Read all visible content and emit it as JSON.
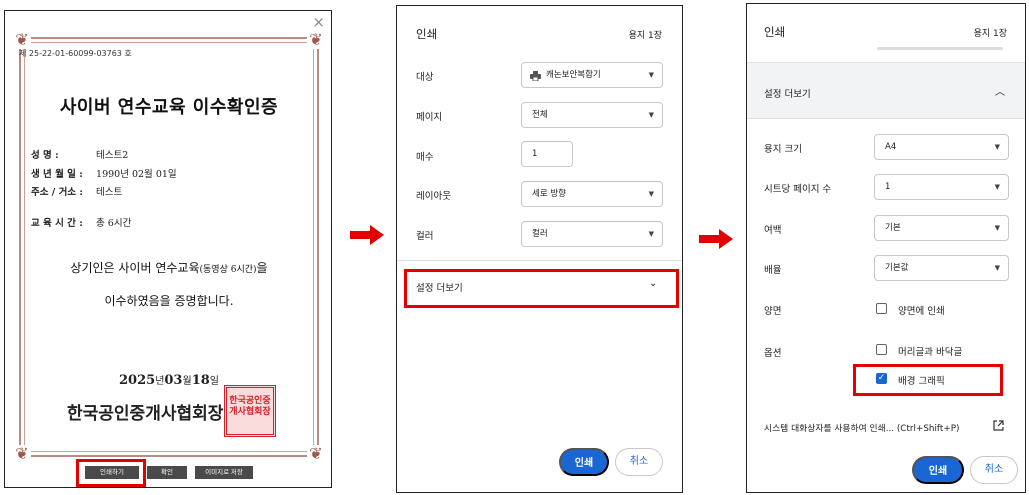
{
  "certificate": {
    "close_glyph": "×",
    "number": "제 25-22-01-60099-03763 호",
    "title": "사이버 연수교육 이수확인증",
    "fields": [
      {
        "label": "성 명 :",
        "value": "테스트2"
      },
      {
        "label": "생 년 월 일 :",
        "value": "1990년 02월 01일"
      },
      {
        "label": "주소 / 거소 :",
        "value": "테스트"
      },
      {
        "label": "교 육 시 간 :",
        "value": "총 6시간"
      }
    ],
    "body_line1_a": "상기인은 사이버 연수교육",
    "body_line1_b": "(동영상 6시간)",
    "body_line1_c": "을",
    "body_line2": "이수하였음을 증명합니다.",
    "date_year": "2025",
    "date_year_unit": "년",
    "date_month": "03",
    "date_month_unit": "월",
    "date_day": "18",
    "date_day_unit": "일",
    "organization": "한국공인중개사협회장",
    "seal_text": "한국공인중개사협회장",
    "buttons": {
      "print": "인쇄하기",
      "confirm": "확인",
      "save_image": "이미지로 저장"
    }
  },
  "arrow_color": "#e40000",
  "highlight_color": "#e40000",
  "print_dialog_1": {
    "title": "인쇄",
    "page_count": "용지 1장",
    "rows": [
      {
        "label": "대상",
        "value": "캐논보안복합기",
        "icon": "printer-icon"
      },
      {
        "label": "페이지",
        "value": "전체"
      },
      {
        "label": "매수",
        "value": "1"
      },
      {
        "label": "레이아웃",
        "value": "세로 방향"
      },
      {
        "label": "컬러",
        "value": "컬러"
      }
    ],
    "more_settings": "설정 더보기",
    "print_button": "인쇄",
    "cancel_button": "취소"
  },
  "print_dialog_2": {
    "title": "인쇄",
    "page_count": "용지 1장",
    "more_settings": "설정 더보기",
    "rows": [
      {
        "label": "용지 크기",
        "value": "A4"
      },
      {
        "label": "시트당 페이지 수",
        "value": "1"
      },
      {
        "label": "여백",
        "value": "기본"
      },
      {
        "label": "배율",
        "value": "기본값"
      }
    ],
    "duplex_label": "양면",
    "duplex_option": "양면에 인쇄",
    "duplex_checked": false,
    "options_label": "옵션",
    "header_footer": "머리글과 바닥글",
    "header_footer_checked": false,
    "background_graphics": "배경 그래픽",
    "background_graphics_checked": true,
    "system_dialog": "시스템 대화상자를 사용하여 인쇄... (Ctrl+Shift+P)",
    "print_button": "인쇄",
    "cancel_button": "취소",
    "accent_color": "#1a66d2"
  }
}
